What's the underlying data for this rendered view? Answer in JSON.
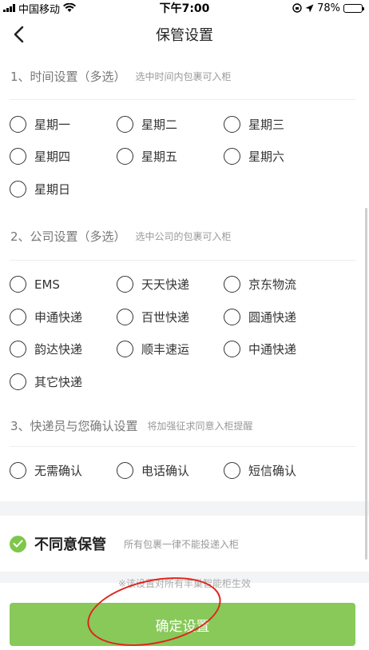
{
  "status_bar": {
    "carrier": "中国移动",
    "time": "下午7:00",
    "battery": "78%",
    "battery_level": 0.78
  },
  "nav": {
    "title": "保管设置"
  },
  "section1": {
    "title": "1、时间设置（多选）",
    "hint": "选中时间内包裹可入柜",
    "options": [
      "星期一",
      "星期二",
      "星期三",
      "星期四",
      "星期五",
      "星期六",
      "星期日"
    ]
  },
  "section2": {
    "title": "2、公司设置（多选）",
    "hint": "选中公司的包裹可入柜",
    "options": [
      "EMS",
      "天天快递",
      "京东物流",
      "申通快递",
      "百世快递",
      "圆通快递",
      "韵达快递",
      "顺丰速运",
      "中通快递",
      "其它快递"
    ]
  },
  "section3": {
    "title": "3、快递员与您确认设置",
    "hint": "将加强征求同意入柜提醒",
    "options": [
      "无需确认",
      "电话确认",
      "短信确认"
    ]
  },
  "refuse": {
    "label": "不同意保管",
    "hint": "所有包裹一律不能投递入柜",
    "checked": true
  },
  "footer": {
    "note": "※该设置对所有丰巢智能柜生效",
    "button": "确定设置"
  },
  "colors": {
    "accent_green": "#88c95a",
    "check_green": "#7ec74c",
    "annotation_red": "#e0241b"
  }
}
